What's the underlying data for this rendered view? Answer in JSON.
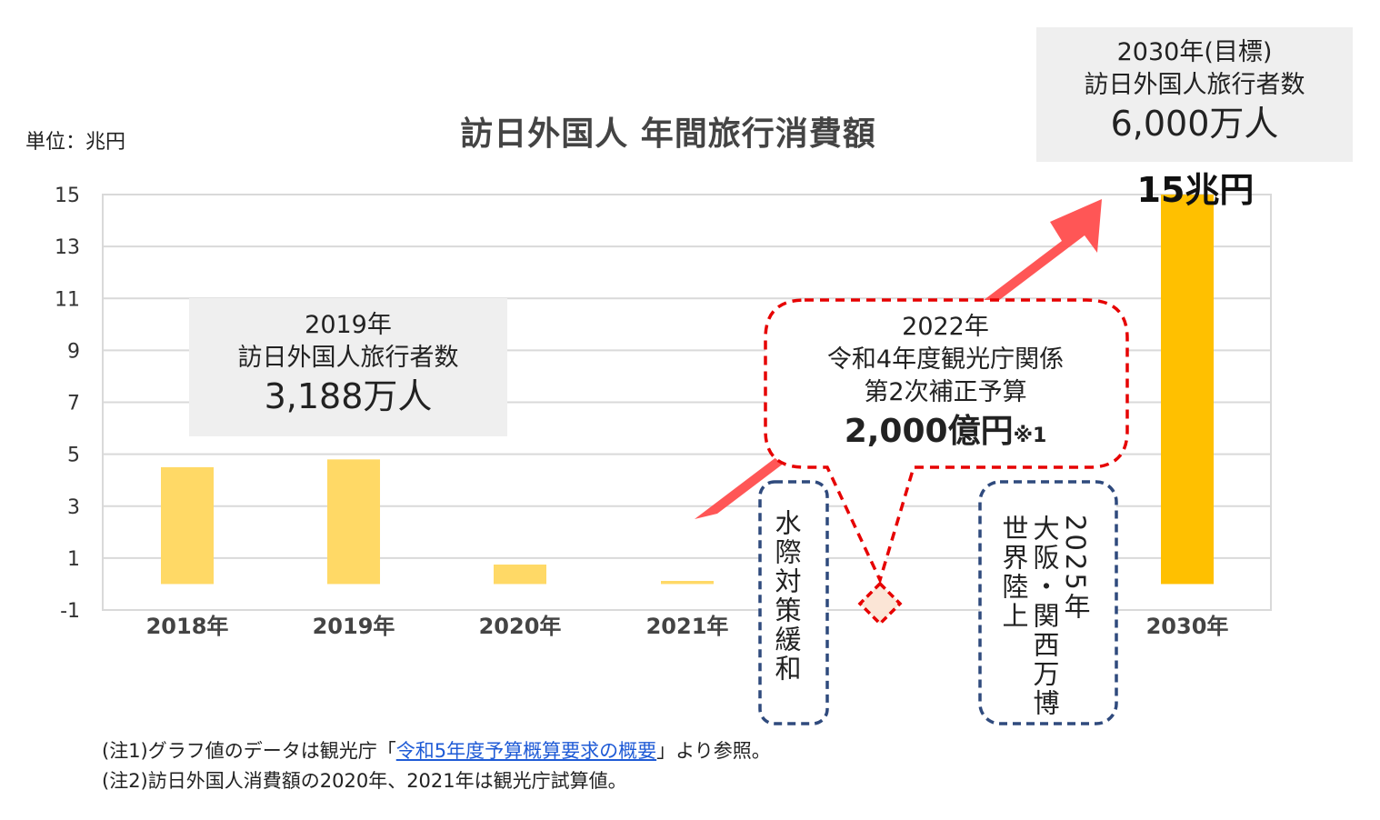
{
  "unit_label": "単位：兆円",
  "chart_data": {
    "type": "bar",
    "title": "訪日外国人 年間旅行消費額",
    "categories": [
      "2018年",
      "2019年",
      "2020年",
      "2021年",
      "2030年"
    ],
    "values": [
      4.5,
      4.8,
      0.75,
      0.12,
      15
    ],
    "ylim": [
      -1,
      15
    ],
    "y_ticks": [
      "15",
      "13",
      "11",
      "9",
      "7",
      "5",
      "3",
      "1",
      "-1"
    ],
    "grid": true,
    "colors": {
      "bar_past": "#FFD966",
      "bar_target": "#FFC000",
      "arrow": "#FF4D4D",
      "callout_red": "#E60000",
      "callout_blue": "#2F4A7D",
      "label_box": "#EFEFEF"
    },
    "value_label_2030": "15兆円"
  },
  "annotations": {
    "box_2019": {
      "year": "2019年",
      "label": "訪日外国人旅行者数",
      "value": "3,188万人"
    },
    "box_2030": {
      "year": "2030年(目標)",
      "label": "訪日外国人旅行者数",
      "value": "6,000万人"
    },
    "budget_callout": {
      "year": "2022年",
      "line1": "令和4年度観光庁関係",
      "line2": "第2次補正予算",
      "amount": "2,000億円",
      "note_mark": "※1"
    },
    "water_easing": "水際対策緩和",
    "expo_col1": "2025年",
    "expo_col2": "大阪・関西万博",
    "expo_col3": "世界陸上"
  },
  "notes": {
    "n1_prefix": "(注1)グラフ値のデータは観光庁「",
    "n1_link": "令和5年度予算概算要求の概要",
    "n1_suffix": "」より参照。",
    "n2": "(注2)訪日外国人消費額の2020年、2021年は観光庁試算値。"
  }
}
